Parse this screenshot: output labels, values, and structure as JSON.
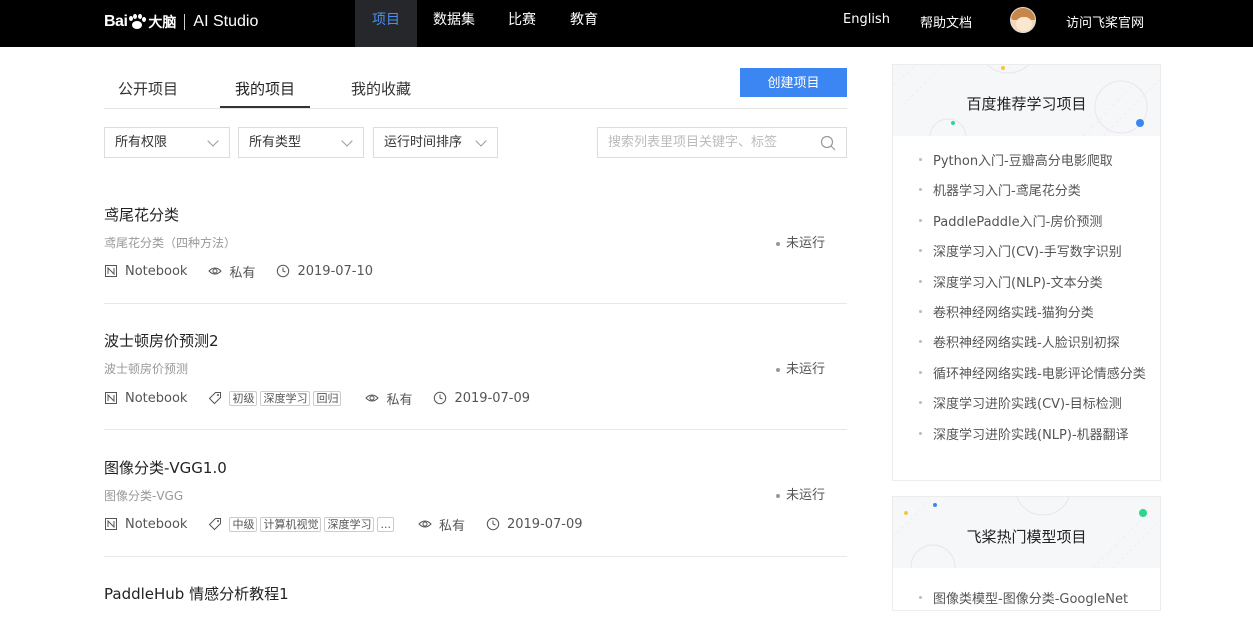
{
  "nav": {
    "brand_bai": "Bai",
    "brand_daxiang": "大脑",
    "brand_studio": "AI Studio",
    "tabs": [
      "项目",
      "数据集",
      "比赛",
      "教育"
    ],
    "active_tab": "项目",
    "english": "English",
    "help": "帮助文档",
    "visit": "访问飞桨官网"
  },
  "main": {
    "tabs": [
      "公开项目",
      "我的项目",
      "我的收藏"
    ],
    "active_tab": "我的项目",
    "create_button": "创建项目",
    "filters": [
      "所有权限",
      "所有类型",
      "运行时间排序"
    ],
    "search_placeholder": "搜索列表里项目关键字、标签"
  },
  "projects": [
    {
      "title": "鸢尾花分类",
      "desc": "鸢尾花分类（四种方法）",
      "type": "Notebook",
      "tags": [],
      "visibility": "私有",
      "date": "2019-07-10",
      "status": "未运行"
    },
    {
      "title": "波士顿房价预测2",
      "desc": "波士顿房价预测",
      "type": "Notebook",
      "tags": [
        "初级",
        "深度学习",
        "回归"
      ],
      "visibility": "私有",
      "date": "2019-07-09",
      "status": "未运行"
    },
    {
      "title": "图像分类-VGG1.0",
      "desc": "图像分类-VGG",
      "type": "Notebook",
      "tags": [
        "中级",
        "计算机视觉",
        "深度学习",
        "..."
      ],
      "visibility": "私有",
      "date": "2019-07-09",
      "status": "未运行"
    },
    {
      "title": "PaddleHub 情感分析教程1"
    }
  ],
  "sidebar": {
    "card1": {
      "title": "百度推荐学习项目",
      "items": [
        "Python入门-豆瓣高分电影爬取",
        "机器学习入门-鸢尾花分类",
        "PaddlePaddle入门-房价预测",
        "深度学习入门(CV)-手写数字识别",
        "深度学习入门(NLP)-文本分类",
        "卷积神经网络实践-猫狗分类",
        "卷积神经网络实践-人脸识别初探",
        "循环神经网络实践-电影评论情感分类",
        "深度学习进阶实践(CV)-目标检测",
        "深度学习进阶实践(NLP)-机器翻译"
      ]
    },
    "card2": {
      "title": "飞桨热门模型项目",
      "items": [
        "图像类模型-图像分类-GoogleNet"
      ]
    }
  },
  "colors": {
    "accent": "#3b86f2",
    "nav_bg": "#000000",
    "active_nav_text": "#4b8ff0"
  }
}
